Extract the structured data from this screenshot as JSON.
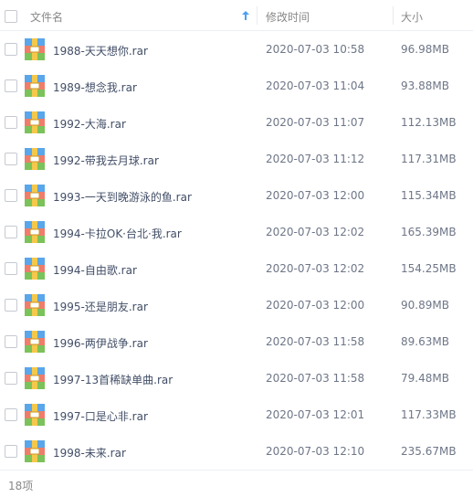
{
  "header": {
    "name_label": "文件名",
    "time_label": "修改时间",
    "size_label": "大小",
    "sort_icon": "arrow-up-icon"
  },
  "files": [
    {
      "name": "1988-天天想你.rar",
      "modified": "2020-07-03 10:58",
      "size": "96.98MB"
    },
    {
      "name": "1989-想念我.rar",
      "modified": "2020-07-03 11:04",
      "size": "93.88MB"
    },
    {
      "name": "1992-大海.rar",
      "modified": "2020-07-03 11:07",
      "size": "112.13MB"
    },
    {
      "name": "1992-带我去月球.rar",
      "modified": "2020-07-03 11:12",
      "size": "117.31MB"
    },
    {
      "name": "1993-一天到晚游泳的鱼.rar",
      "modified": "2020-07-03 12:00",
      "size": "115.34MB"
    },
    {
      "name": "1994-卡拉OK·台北·我.rar",
      "modified": "2020-07-03 12:02",
      "size": "165.39MB"
    },
    {
      "name": "1994-自由歌.rar",
      "modified": "2020-07-03 12:02",
      "size": "154.25MB"
    },
    {
      "name": "1995-还是朋友.rar",
      "modified": "2020-07-03 12:00",
      "size": "90.89MB"
    },
    {
      "name": "1996-两伊战争.rar",
      "modified": "2020-07-03 11:58",
      "size": "89.63MB"
    },
    {
      "name": "1997-13首稀缺单曲.rar",
      "modified": "2020-07-03 11:58",
      "size": "79.48MB"
    },
    {
      "name": "1997-口是心非.rar",
      "modified": "2020-07-03 12:01",
      "size": "117.33MB"
    },
    {
      "name": "1998-未来.rar",
      "modified": "2020-07-03 12:10",
      "size": "235.67MB"
    }
  ],
  "file_icon": "rar-archive-icon",
  "footer": {
    "count_label": "18项"
  },
  "colors": {
    "accent": "#4a9ff5",
    "header_text": "#888888",
    "row_text": "#424e67",
    "border": "#eceff4"
  }
}
